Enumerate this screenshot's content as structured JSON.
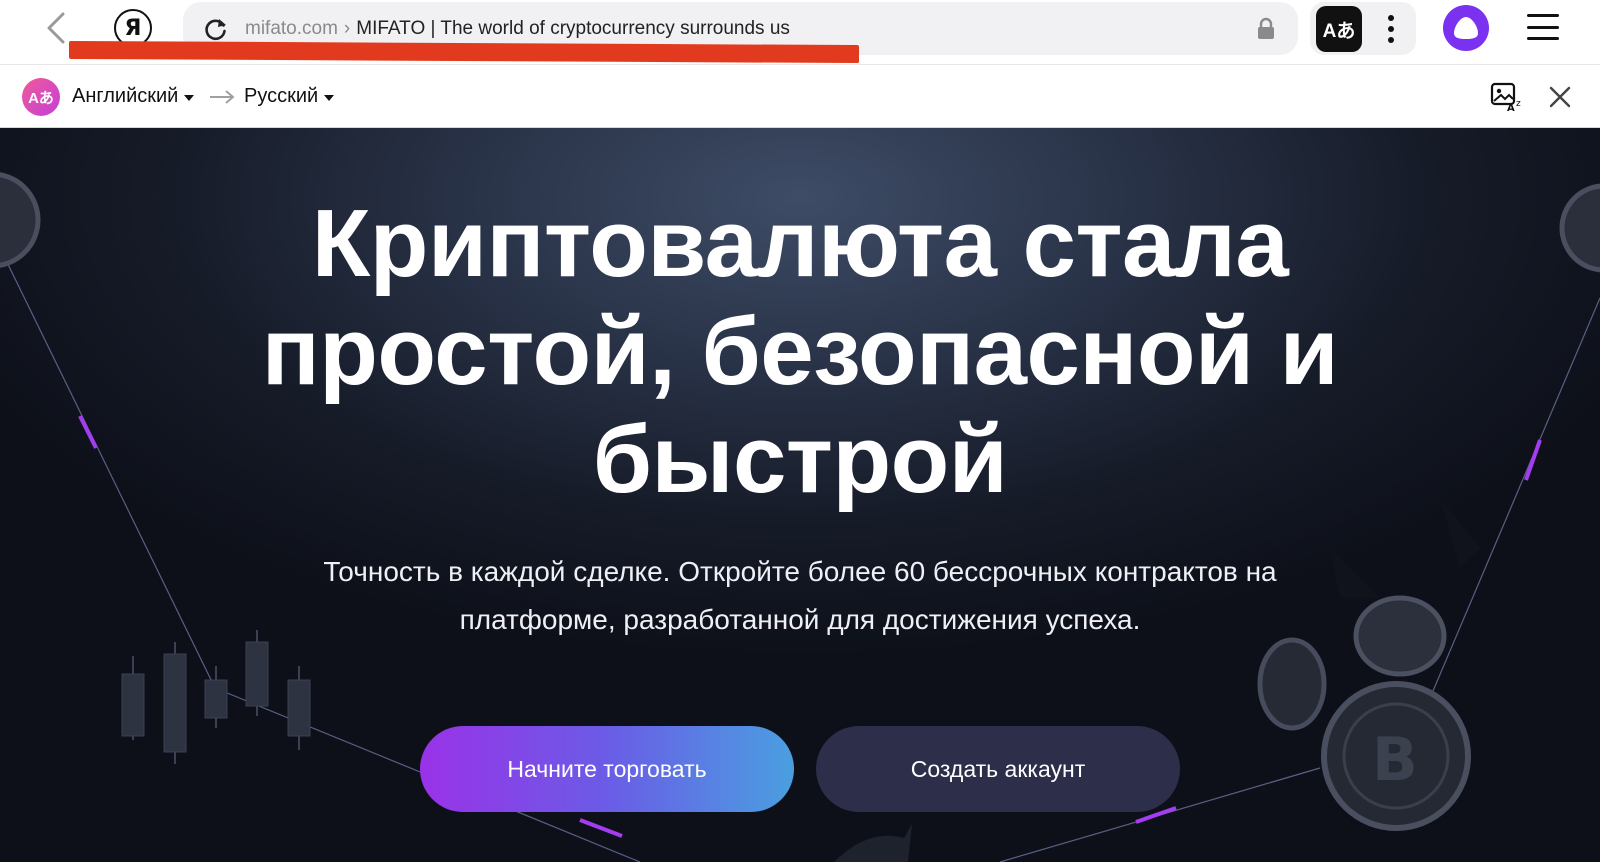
{
  "browser": {
    "url_domain": "mifato.com",
    "url_separator": "›",
    "page_title": "MIFATO | The world of cryptocurrency surrounds us",
    "logo_letter": "Я",
    "translate_app_glyph": "Aあ"
  },
  "translation_bar": {
    "logo_glyph": "Aあ",
    "source_language": "Английский",
    "target_language": "Русский"
  },
  "hero": {
    "title": "Криптовалюта стала простой, безопасной и быстрой",
    "subtitle": "Точность в каждой сделке. Откройте более 60 бессрочных контрактов на платформе, разработанной для достижения успеха.",
    "primary_button": "Начните торговать",
    "secondary_button": "Создать аккаунт"
  },
  "icons": [
    "back-icon",
    "yandex-logo",
    "reload-icon",
    "lock-icon",
    "translate-app-icon",
    "kebab-menu-icon",
    "alice-icon",
    "hamburger-menu-icon",
    "translate-logo-icon",
    "arrow-right-icon",
    "image-translate-icon",
    "close-icon"
  ],
  "colors": {
    "url_underline_mark": "#e23a1e",
    "alice": "#7a32f0",
    "primary_button_start": "#9a32e8",
    "primary_button_end": "#4a9fe0",
    "secondary_button": "#2c2e4a"
  }
}
